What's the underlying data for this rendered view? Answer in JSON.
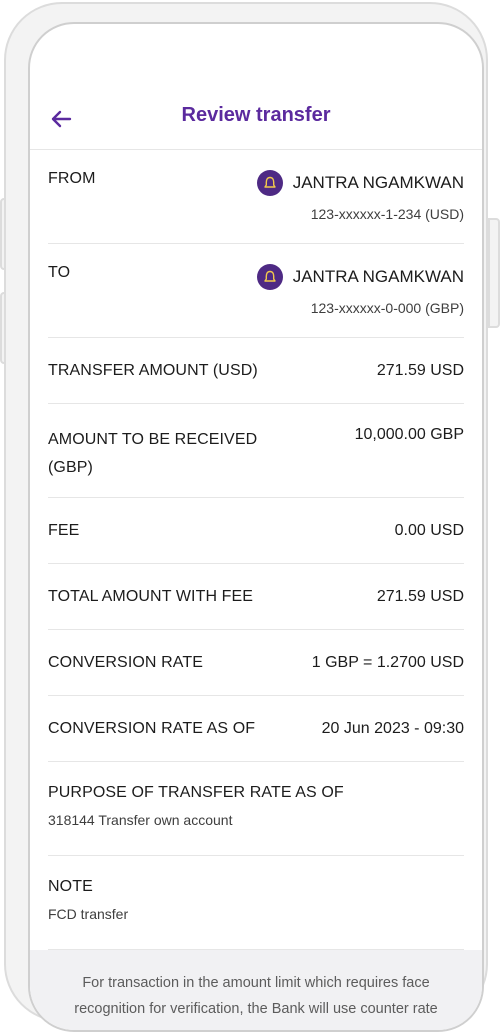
{
  "header": {
    "title": "Review transfer"
  },
  "from": {
    "label": "FROM",
    "name": "JANTRA NGAMKWAN",
    "account": "123-xxxxxx-1-234 (USD)"
  },
  "to": {
    "label": "TO",
    "name": "JANTRA NGAMKWAN",
    "account": "123-xxxxxx-0-000 (GBP)"
  },
  "transfer_amount": {
    "label": "TRANSFER AMOUNT (USD)",
    "value": "271.59 USD"
  },
  "amount_received": {
    "label": "AMOUNT TO BE RECEIVED (GBP)",
    "value": "10,000.00 GBP"
  },
  "fee": {
    "label": "FEE",
    "value": "0.00 USD"
  },
  "total_with_fee": {
    "label": "TOTAL AMOUNT WITH FEE",
    "value": "271.59 USD"
  },
  "conversion_rate": {
    "label": "CONVERSION RATE",
    "value": "1 GBP = 1.2700 USD"
  },
  "conversion_rate_as_of": {
    "label": "CONVERSION RATE AS OF",
    "value": "20 Jun 2023 - 09:30"
  },
  "purpose": {
    "label": "PURPOSE OF TRANSFER RATE AS OF",
    "value": "318144 Transfer own account"
  },
  "note": {
    "label": "NOTE",
    "value": "FCD transfer"
  },
  "disclaimer": "For transaction in the amount limit which requires face recognition for verification, the Bank will use counter rate",
  "colors": {
    "accent": "#5b2a9e",
    "bank_logo": "#4e2a84",
    "bank_logo_icon": "#f2c94c"
  },
  "icons": {
    "back": "arrow-left-icon",
    "bank": "bank-logo-icon"
  }
}
